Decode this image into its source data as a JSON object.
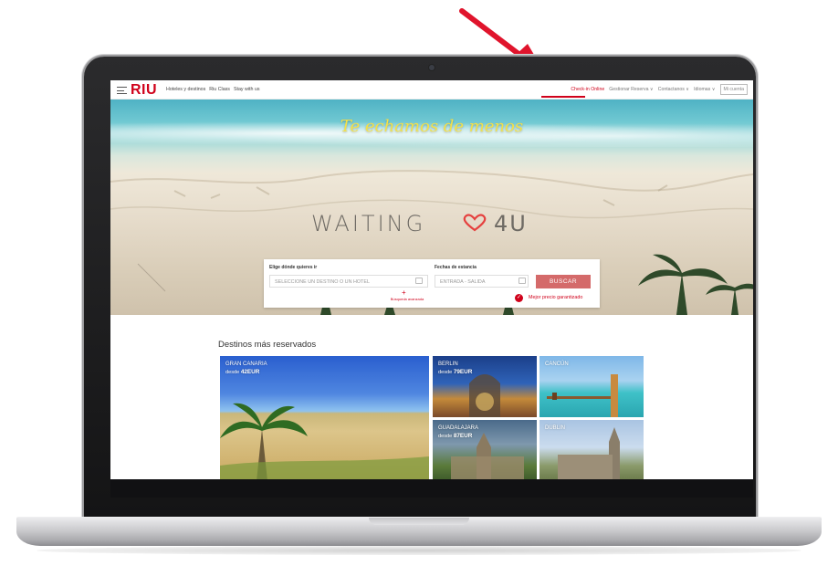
{
  "colors": {
    "brand": "#d0021b",
    "arrow": "#e0142c",
    "button": "#d46a6a",
    "hero_title": "#f3e04a"
  },
  "nav": {
    "logo": "RIU",
    "left_links": [
      "Hoteles y destinos",
      "Riu Class",
      "Stay with us"
    ],
    "right_links": [
      "Check-in Online",
      "Gestionar Reserva ∨",
      "Contactanos ∨",
      "Idiomas ∨"
    ],
    "account_button": "Mi cuenta",
    "menu_icon": "hamburger-icon"
  },
  "hero": {
    "title": "Te echamos de menos",
    "sand_text": "WAITING",
    "sand_suffix": "4U"
  },
  "search": {
    "destination_label": "Elige dónde quieres ir",
    "destination_placeholder": "SELECCIONE UN DESTINO O UN HOTEL",
    "dates_label": "Fechas de estancia",
    "dates_placeholder": "ENTRADA - SALIDA",
    "search_button": "BUSCAR",
    "advanced_search": "Búsqueda avanzada",
    "best_price": "Mejor precio garantizado"
  },
  "destinations": {
    "title": "Destinos más reservados",
    "items": [
      {
        "name": "GRAN CANARIA",
        "prefix": "desde",
        "price": "42EUR"
      },
      {
        "name": "BERLIN",
        "prefix": "desde",
        "price": "79EUR"
      },
      {
        "name": "CANCÚN",
        "prefix": "",
        "price": ""
      },
      {
        "name": "GUADALAJARA",
        "prefix": "desde",
        "price": "87EUR"
      },
      {
        "name": "DUBLIN",
        "prefix": "",
        "price": ""
      }
    ]
  }
}
